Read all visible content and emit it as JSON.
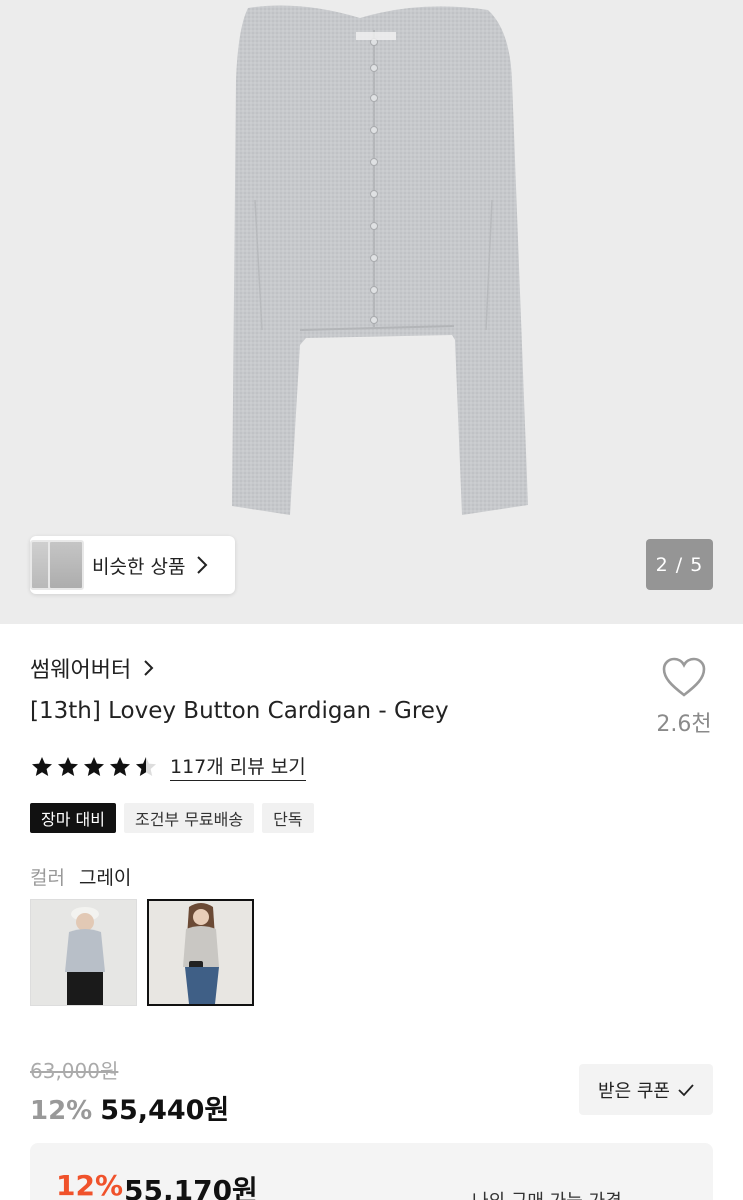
{
  "gallery": {
    "similar_label": "비슷한 상품",
    "pager": "2 / 5"
  },
  "product": {
    "brand": "썸웨어버터",
    "title": "[13th] Lovey Button Cardigan - Grey",
    "like_count": "2.6천",
    "rating": 4.5,
    "review_link": "117개 리뷰 보기",
    "tags": [
      "장마 대비",
      "조건부 무료배송",
      "단독"
    ]
  },
  "color": {
    "label": "컬러",
    "value": "그레이"
  },
  "price": {
    "original": "63,000원",
    "discount_pct": "12%",
    "sale": "55,440원",
    "coupon_button": "받은 쿠폰"
  },
  "best_price": {
    "discount_pct": "12%",
    "amount": "55,170원",
    "label": "나의 구매 가능 가격"
  },
  "colors": {
    "accent": "#f0522b",
    "dark_tag": "#111111"
  }
}
